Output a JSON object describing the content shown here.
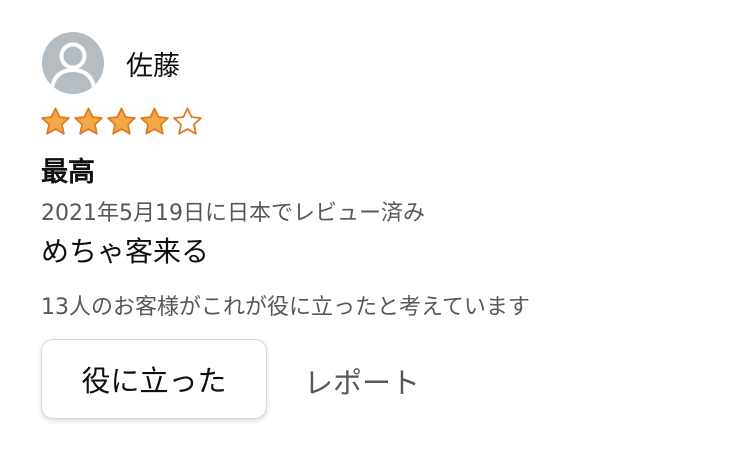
{
  "review": {
    "reviewer_name": "佐藤",
    "avatar_icon": "user-silhouette-icon",
    "rating": {
      "value": 4,
      "max": 5
    },
    "star_colors": {
      "filled": "#f3a847",
      "stroke": "#de7921"
    },
    "title": "最高",
    "date_location": "2021年5月19日に日本でレビュー済み",
    "body": "めちゃ客来る",
    "helpful_count_text": "13人のお客様がこれが役に立ったと考えています",
    "helpful_button_label": "役に立った",
    "report_label": "レポート"
  }
}
